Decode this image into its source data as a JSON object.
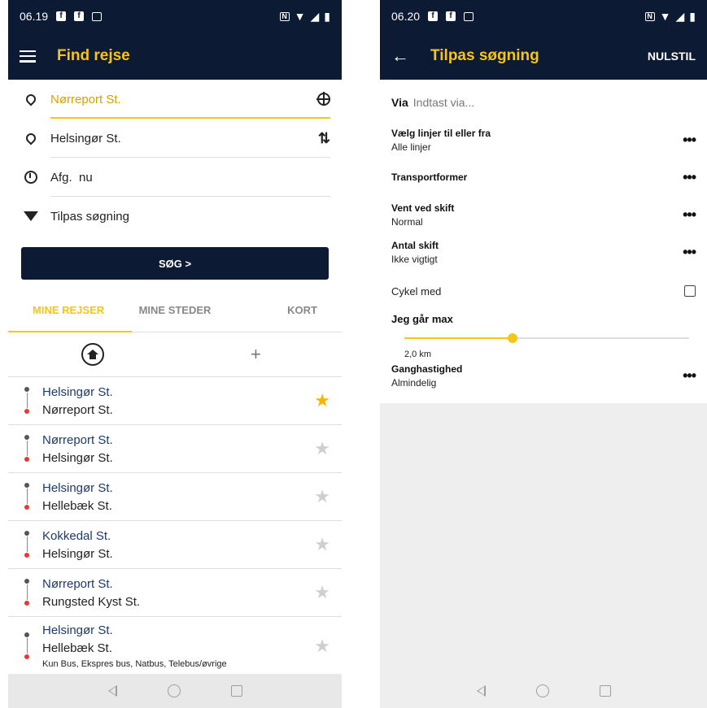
{
  "left": {
    "status": {
      "time": "06.19"
    },
    "appbar": {
      "title": "Find rejse"
    },
    "form": {
      "from": "Nørreport St.",
      "to": "Helsingør St.",
      "time_label": "Afg.",
      "time_value": "nu",
      "filter": "Tilpas søgning"
    },
    "search_button": "SØG >",
    "tabs": [
      "MINE REJSER",
      "MINE STEDER",
      "KORT"
    ],
    "trips": [
      {
        "from": "Helsingør St.",
        "to": "Nørreport St.",
        "favorite": true
      },
      {
        "from": "Nørreport St.",
        "to": "Helsingør St.",
        "favorite": false
      },
      {
        "from": "Helsingør St.",
        "to": "Hellebæk St.",
        "favorite": false
      },
      {
        "from": "Kokkedal St.",
        "to": "Helsingør St.",
        "favorite": false
      },
      {
        "from": "Nørreport St.",
        "to": "Rungsted Kyst St.",
        "favorite": false
      },
      {
        "from": "Helsingør St.",
        "to": "Hellebæk St.",
        "note": "Kun Bus, Ekspres bus, Natbus, Telebus/øvrige",
        "favorite": false
      }
    ]
  },
  "right": {
    "status": {
      "time": "06.20"
    },
    "appbar": {
      "title": "Tilpas søgning",
      "action": "NULSTIL"
    },
    "via": {
      "label": "Via",
      "placeholder": "Indtast via..."
    },
    "options": {
      "lines": {
        "label": "Vælg linjer til eller fra",
        "value": "Alle linjer"
      },
      "transport": {
        "label": "Transportformer"
      },
      "wait": {
        "label": "Vent ved skift",
        "value": "Normal"
      },
      "changes": {
        "label": "Antal skift",
        "value": "Ikke vigtigt"
      },
      "bike": {
        "label": "Cykel med",
        "checked": false
      },
      "walk": {
        "label": "Jeg går max",
        "value": "2,0 km",
        "fraction": 0.38
      },
      "speed": {
        "label": "Ganghastighed",
        "value": "Almindelig"
      }
    }
  },
  "colors": {
    "appbar": "#0d1a33",
    "accent": "#f5c518",
    "star_active": "#f5b400"
  }
}
